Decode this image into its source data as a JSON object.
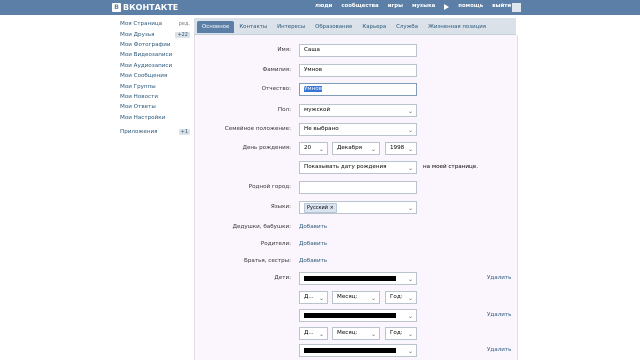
{
  "header": {
    "logo": "ВКОНТАКТЕ",
    "logo_mark": "В",
    "nav": [
      "люди",
      "сообщества",
      "игры",
      "музыка",
      "помощь",
      "выйти"
    ]
  },
  "sidebar": {
    "items": [
      {
        "label": "Моя Страница",
        "extra": "ред."
      },
      {
        "label": "Мои Друзья",
        "badge": "+22"
      },
      {
        "label": "Мои Фотографии"
      },
      {
        "label": "Мои Видеозаписи"
      },
      {
        "label": "Мои Аудиозаписи"
      },
      {
        "label": "Мои Сообщения"
      },
      {
        "label": "Мои Группы"
      },
      {
        "label": "Мои Новости"
      },
      {
        "label": "Мои Ответы"
      },
      {
        "label": "Мои Настройки"
      }
    ],
    "apps": {
      "label": "Приложения",
      "badge": "+1"
    }
  },
  "tabs": [
    "Основное",
    "Контакты",
    "Интересы",
    "Образование",
    "Карьера",
    "Служба",
    "Жизненная позиция"
  ],
  "form": {
    "name": {
      "label": "Имя:",
      "value": "Саша"
    },
    "surname": {
      "label": "Фамилия:",
      "value": "Умнов"
    },
    "patronymic": {
      "label": "Отчество:",
      "value": "Умнов"
    },
    "sex": {
      "label": "Пол:",
      "value": "мужской"
    },
    "family": {
      "label": "Семейное положение:",
      "value": "Не выбрано"
    },
    "birthday": {
      "label": "День рождения:",
      "day": "20",
      "month": "Декабря",
      "year": "1998"
    },
    "show_birthday": {
      "value": "Показывать дату рождения",
      "note": "на моей странице."
    },
    "hometown": {
      "label": "Родной город:",
      "value": ""
    },
    "languages": {
      "label": "Языки:",
      "chip": "Русский",
      "chip_remove": "×"
    },
    "grandparents": {
      "label": "Дедушки, бабушки:",
      "link": "Добавить"
    },
    "parents": {
      "label": "Родители:",
      "link": "Добавить"
    },
    "siblings": {
      "label": "Братья, сестры:",
      "link": "Добавить"
    },
    "children": {
      "label": "Дети:",
      "delete": "Удалить",
      "day_placeholder": "Д...",
      "month_placeholder": "Месяц:",
      "year_placeholder": "Год:"
    }
  }
}
